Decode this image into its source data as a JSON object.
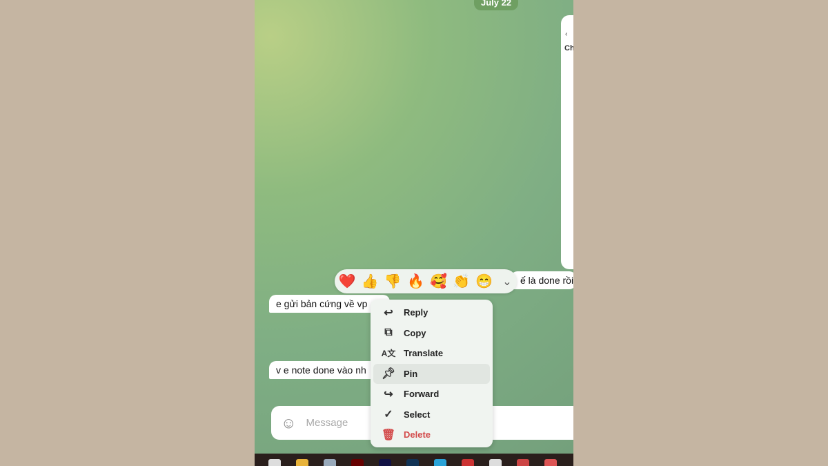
{
  "chat": {
    "date": "July 22",
    "messages": [
      {
        "text": "ế là done rồi"
      },
      {
        "text": "e gửi bản cứng về vp"
      },
      {
        "text": "v e note done vào nh"
      }
    ]
  },
  "side_panel": {
    "back": "‹",
    "title": "Ch"
  },
  "reactions": [
    {
      "emoji": "❤️"
    },
    {
      "emoji": "👍"
    },
    {
      "emoji": "👎"
    },
    {
      "emoji": "🔥"
    },
    {
      "emoji": "🥰"
    },
    {
      "emoji": "👏"
    },
    {
      "emoji": "😁"
    }
  ],
  "reactions_more": "⌄",
  "context_menu": [
    {
      "label": "Reply",
      "icon": "reply-icon",
      "glyph": "↩"
    },
    {
      "label": "Copy",
      "icon": "copy-icon",
      "glyph": "⧉"
    },
    {
      "label": "Translate",
      "icon": "translate-icon",
      "glyph": "A文"
    },
    {
      "label": "Pin",
      "icon": "pin-icon",
      "glyph": "📌︎"
    },
    {
      "label": "Forward",
      "icon": "forward-icon",
      "glyph": "↪"
    },
    {
      "label": "Select",
      "icon": "select-icon",
      "glyph": "✓"
    },
    {
      "label": "Delete",
      "icon": "delete-icon",
      "glyph": "🗑︎"
    }
  ],
  "composer": {
    "placeholder": "Message",
    "emoji_glyph": "☺"
  },
  "colors": {
    "delete": "#d34b4b",
    "page_bg": "#c5b5a2"
  }
}
